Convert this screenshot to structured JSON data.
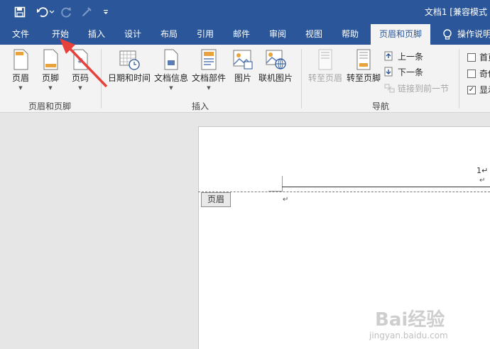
{
  "window": {
    "title": "文档1 [兼容模式"
  },
  "qat": {
    "save_icon": "save-icon",
    "undo_icon": "undo-icon",
    "redo_icon": "redo-icon",
    "format_painter_icon": "format-painter-icon",
    "customize_icon": "customize-qat-icon"
  },
  "tabs": [
    {
      "label": "文件"
    },
    {
      "label": "开始"
    },
    {
      "label": "插入"
    },
    {
      "label": "设计"
    },
    {
      "label": "布局"
    },
    {
      "label": "引用"
    },
    {
      "label": "邮件"
    },
    {
      "label": "审阅"
    },
    {
      "label": "视图"
    },
    {
      "label": "帮助"
    },
    {
      "label": "页眉和页脚"
    },
    {
      "label": "操作说明"
    }
  ],
  "ribbon": {
    "group1": {
      "label": "页眉和页脚",
      "header": "页眉",
      "footer": "页脚",
      "page_number": "页码"
    },
    "group2": {
      "label": "插入",
      "datetime": "日期和时间",
      "docinfo": "文档信息",
      "quickparts": "文档部件",
      "picture": "图片",
      "online_picture": "联机图片"
    },
    "group3": {
      "label": "导航",
      "goto_header": "转至页眉",
      "goto_footer": "转至页脚",
      "previous": "上一条",
      "next": "下一条",
      "link_previous": "链接到前一节"
    },
    "group4": {
      "first_page": "首页",
      "odd_even": "奇偶",
      "show": "显示"
    }
  },
  "document": {
    "header_tag": "页眉",
    "page_number": "1",
    "para_mark": "↵"
  },
  "colors": {
    "accent": "#2b579a",
    "ribbon_bg": "#f3f3f3",
    "annotation_arrow": "#e8413c"
  },
  "watermark": {
    "text": "Bai经验",
    "url": "jingyan.baidu.com"
  }
}
